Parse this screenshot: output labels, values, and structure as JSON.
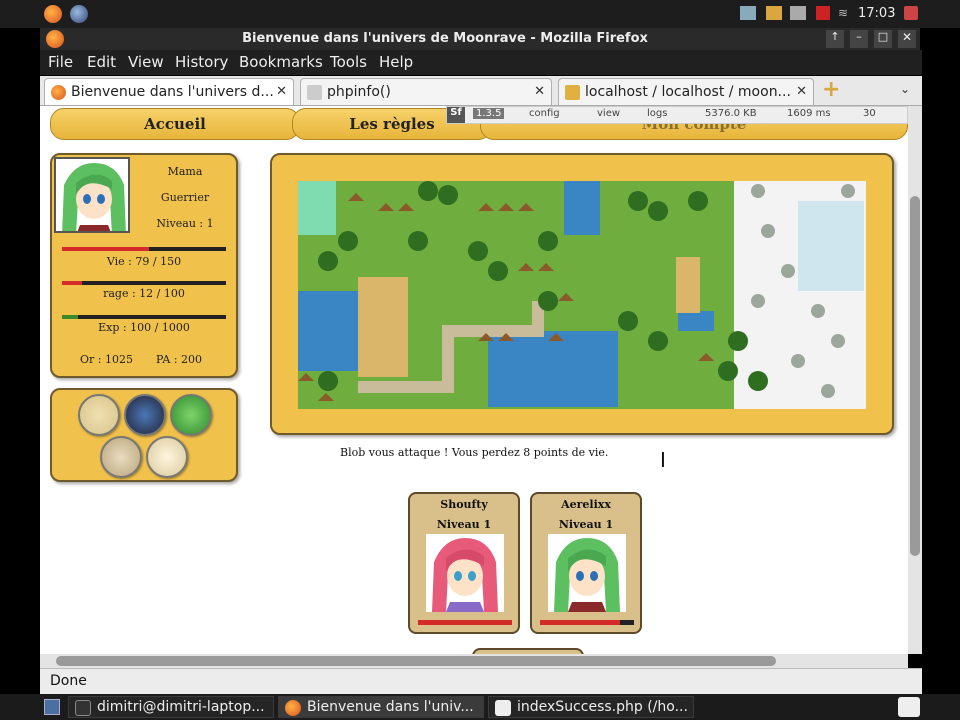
{
  "panel": {
    "clock": "17:03"
  },
  "window": {
    "title": "Bienvenue dans l'univers de Moonrave - Mozilla Firefox"
  },
  "menu": [
    "File",
    "Edit",
    "View",
    "History",
    "Bookmarks",
    "Tools",
    "Help"
  ],
  "tabs": [
    {
      "label": "Bienvenue dans l'univers d...",
      "active": true
    },
    {
      "label": "phpinfo()",
      "active": false
    },
    {
      "label": "localhost / localhost / moon...",
      "active": false
    }
  ],
  "devbar": {
    "badge": "Sf",
    "version": "1.3.5",
    "config": "config",
    "view": "view",
    "logs": "logs",
    "memory": "5376.0 KB",
    "time": "1609 ms",
    "queries": "30"
  },
  "nav": {
    "home": "Accueil",
    "rules": "Les règles",
    "account": "Mon compte"
  },
  "character": {
    "name": "Mama",
    "class": "Guerrier",
    "level": "Niveau : 1",
    "life": "Vie : 79 / 150",
    "life_ratio": 0.53,
    "rage": "rage : 12 / 100",
    "rage_ratio": 0.12,
    "exp": "Exp : 100 / 1000",
    "exp_ratio": 0.1,
    "gold": "Or : 1025",
    "pa": "PA : 200"
  },
  "message": "Blob vous attaque ! Vous perdez 8 points de vie.",
  "players": [
    {
      "name": "Shoufty",
      "level": "Niveau 1",
      "hp_ratio": 1.0,
      "hair": "#e85a7a"
    },
    {
      "name": "Aerelixx",
      "level": "Niveau 1",
      "hp_ratio": 0.85,
      "hair": "#5cc060"
    }
  ],
  "status": "Done",
  "taskbar": [
    {
      "label": "dimitri@dimitri-laptop...",
      "active": false
    },
    {
      "label": "Bienvenue dans l'univ...",
      "active": true
    },
    {
      "label": "indexSuccess.php (/ho...",
      "active": false
    }
  ],
  "colors": {
    "gold": "#f0c14b",
    "life": "#d42a2a",
    "rage": "#d42a2a",
    "exp": "#3a8a2a"
  }
}
